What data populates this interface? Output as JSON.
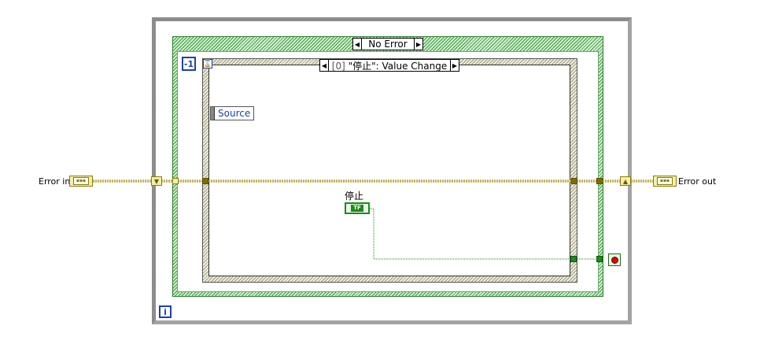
{
  "case_selector": {
    "label": "No Error",
    "left_arrow": "◀",
    "right_arrow": "▶"
  },
  "event_selector": {
    "index": "[0]",
    "label": "\"停止\": Value Change",
    "left_arrow": "◀",
    "right_arrow": "▶"
  },
  "event_timeout": {
    "value": "-1",
    "icon": "hourglass-icon"
  },
  "event_data_node": {
    "field": "Source"
  },
  "iteration_terminal": {
    "label": "i"
  },
  "terminals": {
    "error_in": "Error in",
    "error_out": "Error out",
    "stop_control": "停止",
    "tf_glyph": "TF",
    "cluster_glyph": "▪▪▪"
  },
  "colors": {
    "error_wire": "#8c7b00",
    "boolean_wire": "#1e8a1e",
    "while_loop_border": "#8c8c8c",
    "case_structure": "#3e9b3e",
    "stop_button": "#e00000"
  }
}
